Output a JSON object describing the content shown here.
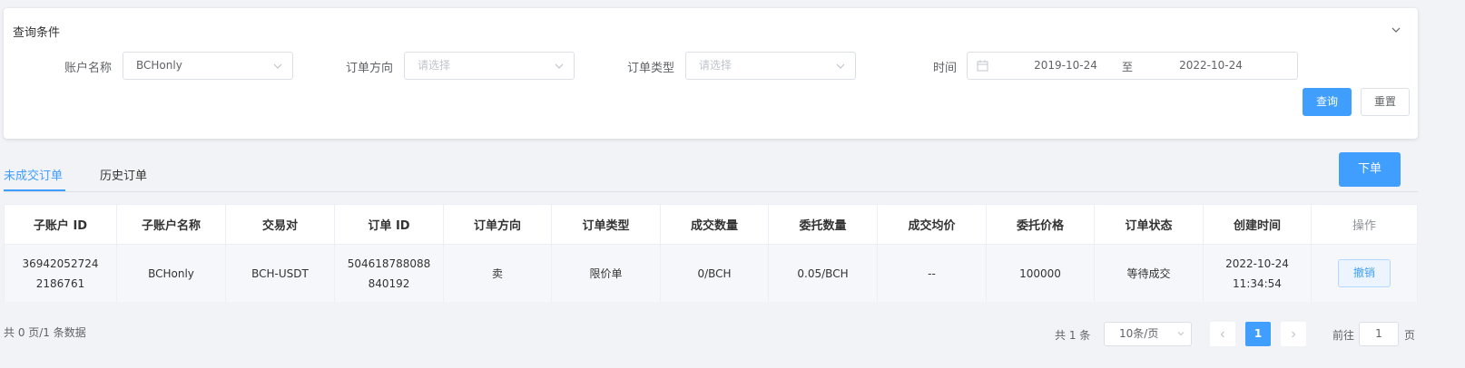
{
  "query": {
    "title": "查询条件",
    "account_label": "账户名称",
    "account_value": "BCHonly",
    "direction_label": "订单方向",
    "direction_placeholder": "请选择",
    "type_label": "订单类型",
    "type_placeholder": "请选择",
    "time_label": "时间",
    "date_start": "2019-10-24",
    "date_sep": "至",
    "date_end": "2022-10-24",
    "search_button": "查询",
    "reset_button": "重置"
  },
  "tabs": [
    {
      "label": "未成交订单",
      "active": true
    },
    {
      "label": "历史订单",
      "active": false
    }
  ],
  "place_order_button": "下单",
  "table": {
    "headers": [
      "子账户 ID",
      "子账户名称",
      "交易对",
      "订单 ID",
      "订单方向",
      "订单类型",
      "成交数量",
      "委托数量",
      "成交均价",
      "委托价格",
      "订单状态",
      "创建时间",
      "操作"
    ],
    "rows": [
      {
        "sub_account_id": "369420527242186761",
        "sub_account_name": "BCHonly",
        "pair": "BCH-USDT",
        "order_id": "504618788088840192",
        "direction": "卖",
        "type": "限价单",
        "filled_qty": "0/BCH",
        "order_qty": "0.05/BCH",
        "avg_price": "--",
        "order_price": "100000",
        "status": "等待成交",
        "created": "2022-10-24 11:34:54",
        "action": "撤销"
      }
    ]
  },
  "footer": {
    "total_text": "共 0 页/1 条数据"
  },
  "pagination": {
    "total": "共 1 条",
    "page_size": "10条/页",
    "current_page": "1",
    "goto_label": "前往",
    "goto_value": "1",
    "goto_unit": "页"
  },
  "colors": {
    "primary": "#409eff",
    "background": "#f2f3f7"
  }
}
